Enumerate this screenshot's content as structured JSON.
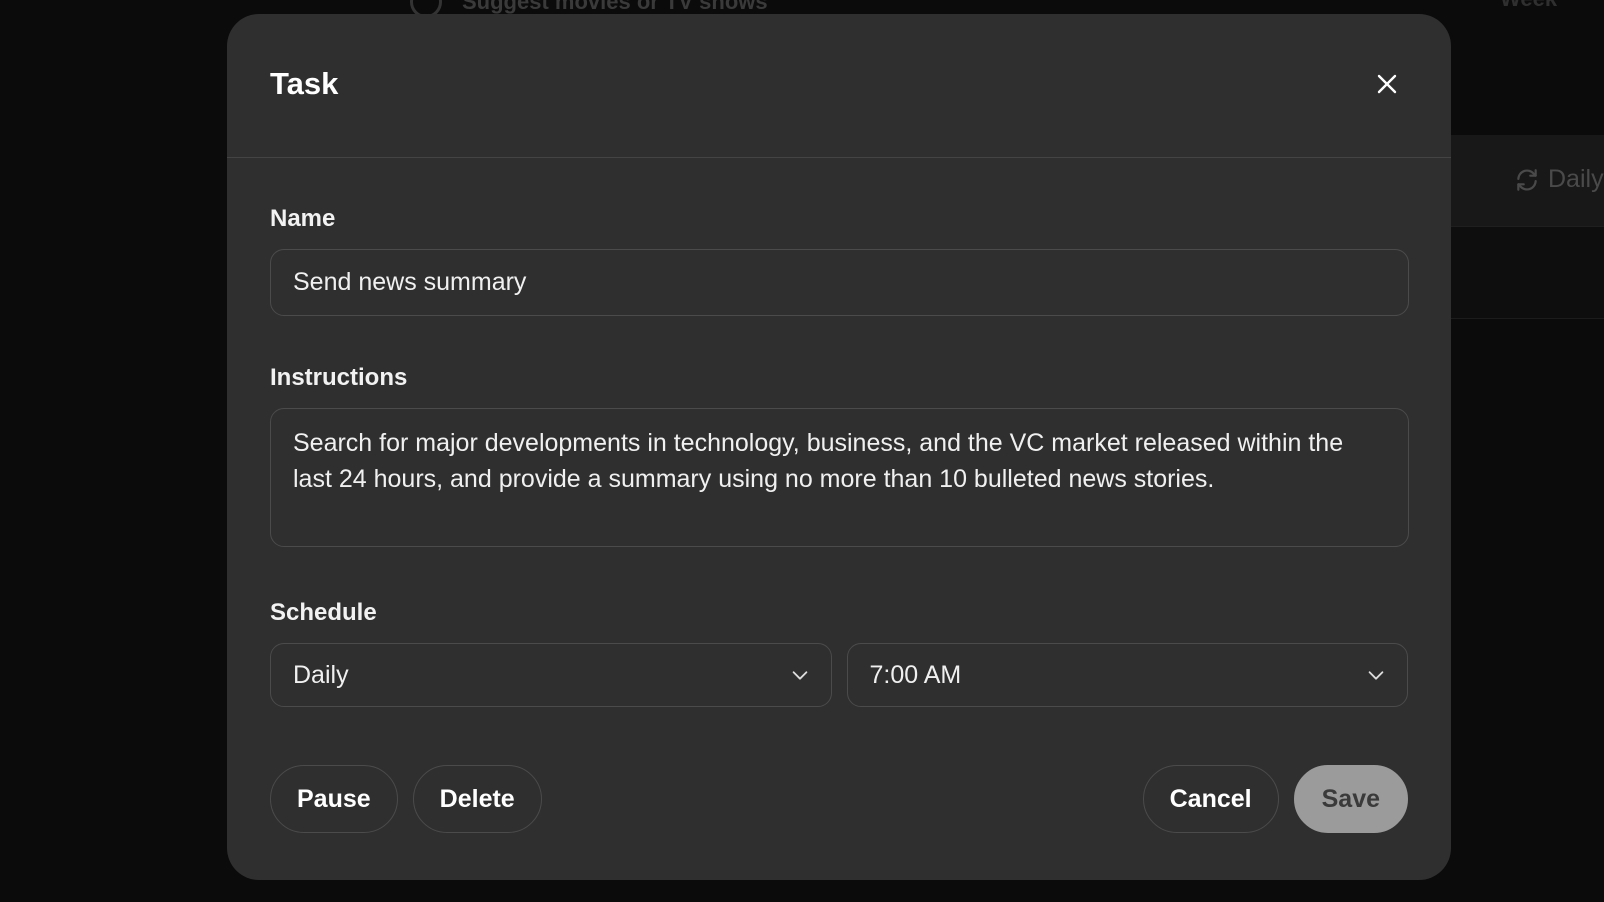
{
  "background": {
    "top_item_text": "Suggest movies or TV shows",
    "top_right_text": "Week",
    "schedule_badge": "Daily"
  },
  "modal": {
    "title": "Task",
    "close_icon": "close-icon",
    "name": {
      "label": "Name",
      "value": "Send news summary"
    },
    "instructions": {
      "label": "Instructions",
      "value": "Search for major developments in technology, business, and the VC market released within the last 24 hours, and provide a summary using no more than 10 bulleted news stories."
    },
    "schedule": {
      "label": "Schedule",
      "frequency": "Daily",
      "time": "7:00 AM"
    },
    "buttons": {
      "pause": "Pause",
      "delete": "Delete",
      "cancel": "Cancel",
      "save": "Save"
    }
  },
  "colors": {
    "modal_bg": "#2f2f2f",
    "border": "#4b4b4b",
    "save_bg": "#9b9b9b",
    "backdrop": "#000000"
  }
}
